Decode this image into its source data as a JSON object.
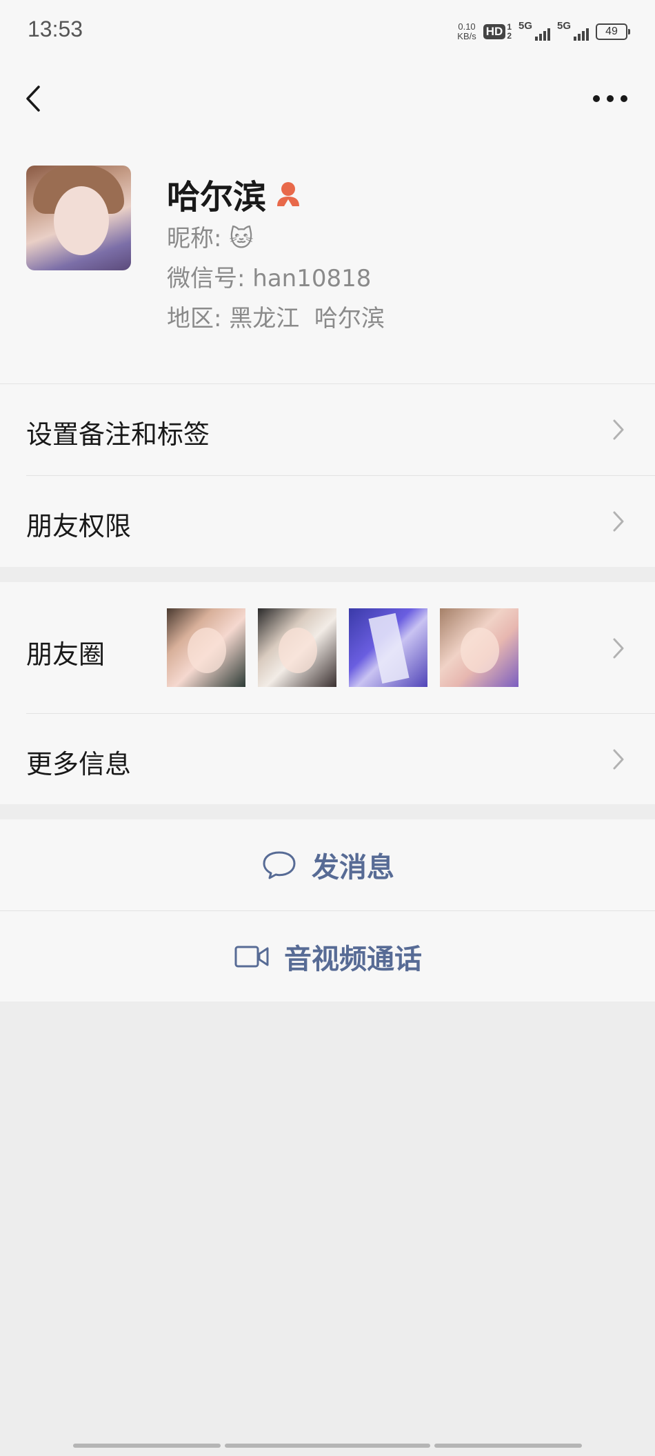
{
  "status_bar": {
    "time": "13:53",
    "net_speed_value": "0.10",
    "net_speed_unit": "KB/s",
    "hd_label": "HD",
    "hd_sim1": "1",
    "hd_sim2": "2",
    "signal1_label": "5G",
    "signal2_label": "5G",
    "battery": "49"
  },
  "profile": {
    "display_name": "哈尔滨",
    "nickname_label": "昵称:",
    "nickname_value": "🐱",
    "wechat_id_label": "微信号:",
    "wechat_id_value": "han10818",
    "region_label": "地区:",
    "region_value": "黑龙江  哈尔滨"
  },
  "menu": {
    "remark_tags": "设置备注和标签",
    "friend_permissions": "朋友权限",
    "moments": "朋友圈",
    "more_info": "更多信息"
  },
  "actions": {
    "send_message": "发消息",
    "video_call": "音视频通话"
  },
  "colors": {
    "link_blue": "#576b95",
    "female_icon": "#e8694a",
    "background": "#ededed",
    "card": "#f7f7f7"
  }
}
